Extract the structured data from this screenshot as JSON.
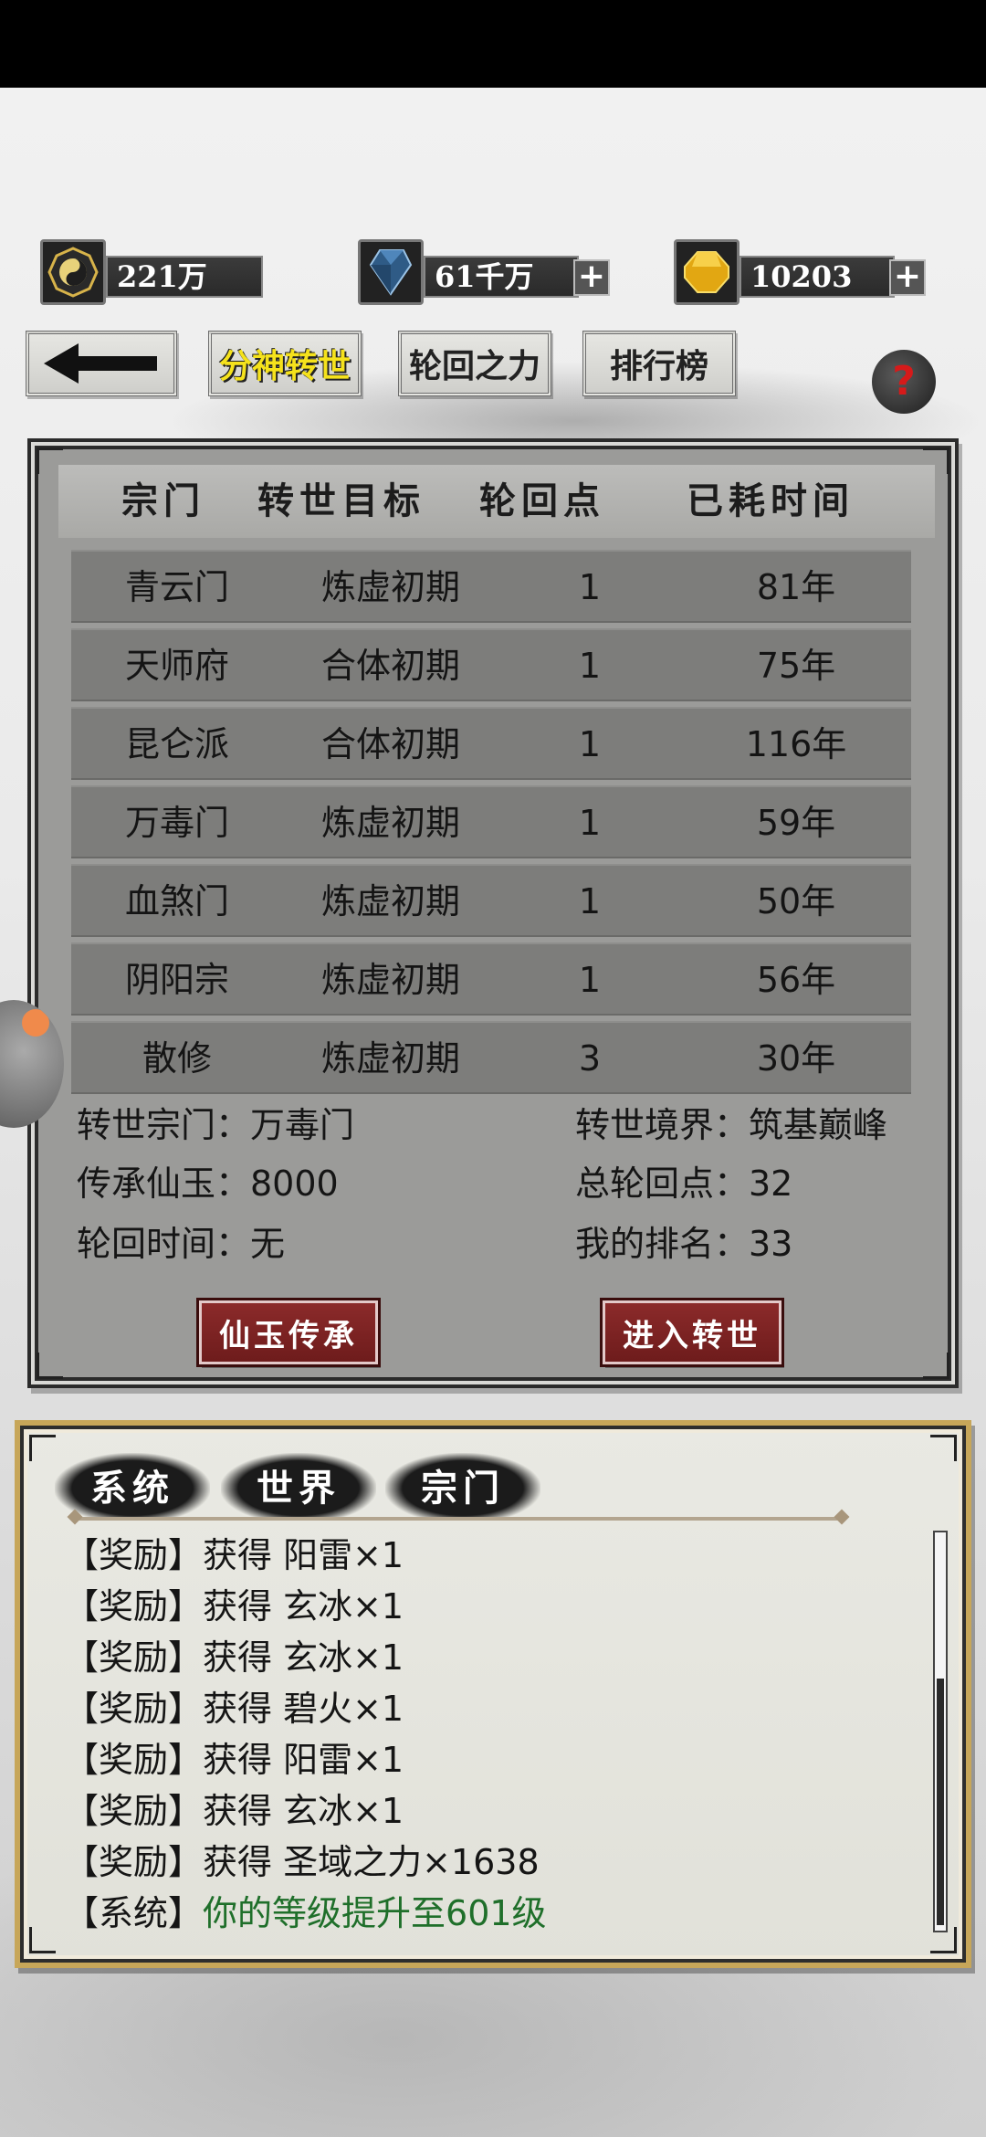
{
  "currencies": [
    {
      "icon": "yin-yang-icon",
      "value": "221万",
      "has_plus": false
    },
    {
      "icon": "blue-crystal-icon",
      "value": "61千万",
      "has_plus": true
    },
    {
      "icon": "gold-gem-icon",
      "value": "10203",
      "has_plus": true
    }
  ],
  "nav": {
    "back_icon": "arrow-left-icon",
    "tabs": [
      {
        "label": "分神转世",
        "active": true
      },
      {
        "label": "轮回之力",
        "active": false
      },
      {
        "label": "排行榜",
        "active": false
      }
    ],
    "help": "?"
  },
  "table": {
    "headers": [
      "宗门",
      "转世目标",
      "轮回点",
      "已耗时间"
    ],
    "rows": [
      [
        "青云门",
        "炼虚初期",
        "1",
        "81年"
      ],
      [
        "天师府",
        "合体初期",
        "1",
        "75年"
      ],
      [
        "昆仑派",
        "合体初期",
        "1",
        "116年"
      ],
      [
        "万毒门",
        "炼虚初期",
        "1",
        "59年"
      ],
      [
        "血煞门",
        "炼虚初期",
        "1",
        "50年"
      ],
      [
        "阴阳宗",
        "炼虚初期",
        "1",
        "56年"
      ],
      [
        "散修",
        "炼虚初期",
        "3",
        "30年"
      ]
    ]
  },
  "info": {
    "left": [
      "转世宗门：万毒门",
      "传承仙玉：8000",
      "轮回时间：无"
    ],
    "right": [
      "转世境界：筑基巅峰",
      "总轮回点：32",
      "我的排名：33"
    ]
  },
  "actions": {
    "inherit": "仙玉传承",
    "enter": "进入转世"
  },
  "chat": {
    "tabs": [
      "系统",
      "世界",
      "宗门"
    ],
    "lines": [
      {
        "tag": "【奖励】",
        "msg": "获得 阳雷×1",
        "green": false
      },
      {
        "tag": "【奖励】",
        "msg": "获得 玄冰×1",
        "green": false
      },
      {
        "tag": "【奖励】",
        "msg": "获得 玄冰×1",
        "green": false
      },
      {
        "tag": "【奖励】",
        "msg": "获得 碧火×1",
        "green": false
      },
      {
        "tag": "【奖励】",
        "msg": "获得 阳雷×1",
        "green": false
      },
      {
        "tag": "【奖励】",
        "msg": "获得 玄冰×1",
        "green": false
      },
      {
        "tag": "【奖励】",
        "msg": "获得 圣域之力×1638",
        "green": false
      },
      {
        "tag": "【系统】",
        "msg": "你的等级提升至601级",
        "green": true
      }
    ]
  },
  "colors": {
    "accent_yellow": "#f5e21c",
    "button_red": "#7a2222",
    "chat_green": "#1f6f2a",
    "gold_border": "#c7a659"
  }
}
